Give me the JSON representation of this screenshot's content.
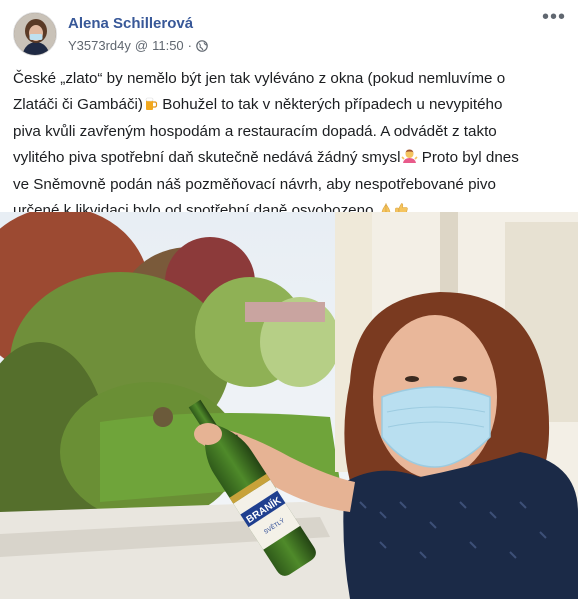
{
  "post": {
    "author": "Alena Schillerová",
    "account": "Y3573rd4y",
    "separator": "@",
    "time": "11:50",
    "dot": "·",
    "more_label": "•••",
    "text_lines": [
      "České „zlato“ by nemělo být jen tak vyléváno z okna (pokud nemluvíme o",
      "Zlatáči či Gambáči)",
      " Bohužel to tak v některých případech u nevypitého",
      "piva kvůli zavřeným hospodám a restauracím dopadá. A odvádět z takto",
      "vylitého piva spotřební daň skutečně nedává žádný smysl",
      " Proto byl dnes",
      "ve Sněmovně podán náš pozměňovací návrh, aby nespotřebované pivo",
      "určené k likvidaci bylo od spotřební daně osvobozeno"
    ],
    "emojis": [
      "beer-icon",
      "woman-shrugging-icon",
      "folded-hands-icon",
      "thumbs-up-icon"
    ]
  },
  "photo": {
    "bottle_label": "BRANÍK",
    "bottle_sublabel": "SVĚTLÝ"
  },
  "colors": {
    "author": "#385898",
    "meta": "#606770",
    "text": "#1c1e21"
  }
}
